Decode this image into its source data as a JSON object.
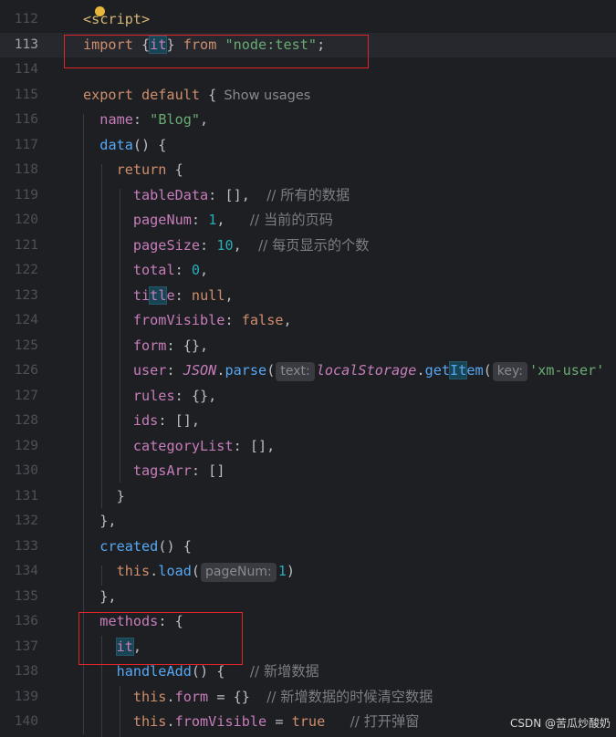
{
  "watermark": "CSDN @苦瓜炒酸奶",
  "colors": {
    "background": "#1e1f22",
    "keyword": "#cf8e6d",
    "string": "#6aab73",
    "number": "#2aacb8",
    "property": "#c77dbb",
    "function": "#56a8f5",
    "comment": "#7a7e85",
    "annotation_box": "#e0242a"
  },
  "lines": [
    {
      "n": "112",
      "seg": [
        [
          "tag",
          "<"
        ],
        [
          "tag",
          "s"
        ],
        [
          "tag",
          "cript"
        ],
        [
          "tag",
          ">"
        ]
      ]
    },
    {
      "n": "113",
      "current": true,
      "seg": [
        [
          "kw",
          "import "
        ],
        [
          "plain",
          "{"
        ],
        [
          "hl",
          "it"
        ],
        [
          "plain",
          "} "
        ],
        [
          "kw",
          "from "
        ],
        [
          "str",
          "\"node:test\""
        ],
        [
          "plain",
          ";"
        ]
      ]
    },
    {
      "n": "114",
      "seg": []
    },
    {
      "n": "115",
      "seg": [
        [
          "kw",
          "export default "
        ],
        [
          "plain",
          "{"
        ],
        [
          "usages",
          "Show usages"
        ]
      ]
    },
    {
      "n": "116",
      "seg": [
        [
          "plain",
          "  "
        ],
        [
          "prop",
          "name"
        ],
        [
          "plain",
          ": "
        ],
        [
          "str",
          "\"Blog\""
        ],
        [
          "plain",
          ","
        ]
      ]
    },
    {
      "n": "117",
      "seg": [
        [
          "plain",
          "  "
        ],
        [
          "fn",
          "data"
        ],
        [
          "plain",
          "() {"
        ]
      ]
    },
    {
      "n": "118",
      "seg": [
        [
          "plain",
          "    "
        ],
        [
          "kw",
          "return "
        ],
        [
          "plain",
          "{"
        ]
      ]
    },
    {
      "n": "119",
      "seg": [
        [
          "plain",
          "      "
        ],
        [
          "prop",
          "tableData"
        ],
        [
          "plain",
          ": [],  "
        ],
        [
          "com",
          "// 所有的数据"
        ]
      ]
    },
    {
      "n": "120",
      "seg": [
        [
          "plain",
          "      "
        ],
        [
          "prop",
          "pageNum"
        ],
        [
          "plain",
          ": "
        ],
        [
          "num",
          "1"
        ],
        [
          "plain",
          ",   "
        ],
        [
          "com",
          "// 当前的页码"
        ]
      ]
    },
    {
      "n": "121",
      "seg": [
        [
          "plain",
          "      "
        ],
        [
          "prop",
          "pageSize"
        ],
        [
          "plain",
          ": "
        ],
        [
          "num",
          "10"
        ],
        [
          "plain",
          ",  "
        ],
        [
          "com",
          "// 每页显示的个数"
        ]
      ]
    },
    {
      "n": "122",
      "seg": [
        [
          "plain",
          "      "
        ],
        [
          "prop",
          "total"
        ],
        [
          "plain",
          ": "
        ],
        [
          "num",
          "0"
        ],
        [
          "plain",
          ","
        ]
      ]
    },
    {
      "n": "123",
      "seg": [
        [
          "plain",
          "      "
        ],
        [
          "prop",
          "ti"
        ],
        [
          "prophl",
          "tl"
        ],
        [
          "prop",
          "e"
        ],
        [
          "plain",
          ": "
        ],
        [
          "kw",
          "null"
        ],
        [
          "plain",
          ","
        ]
      ]
    },
    {
      "n": "124",
      "seg": [
        [
          "plain",
          "      "
        ],
        [
          "prop",
          "fromVisible"
        ],
        [
          "plain",
          ": "
        ],
        [
          "kw",
          "false"
        ],
        [
          "plain",
          ","
        ]
      ]
    },
    {
      "n": "125",
      "seg": [
        [
          "plain",
          "      "
        ],
        [
          "prop",
          "form"
        ],
        [
          "plain",
          ": {},"
        ]
      ]
    },
    {
      "n": "126",
      "seg": [
        [
          "plain",
          "      "
        ],
        [
          "prop",
          "user"
        ],
        [
          "plain",
          ": "
        ],
        [
          "it",
          "JSON"
        ],
        [
          "plain",
          "."
        ],
        [
          "fn",
          "parse"
        ],
        [
          "plain",
          "("
        ],
        [
          "hint",
          "text:"
        ],
        [
          "it",
          "localStorage"
        ],
        [
          "plain",
          "."
        ],
        [
          "fn",
          "get"
        ],
        [
          "fnhl",
          "It"
        ],
        [
          "fn",
          "em"
        ],
        [
          "plain",
          "("
        ],
        [
          "hint",
          "key:"
        ],
        [
          "str",
          "'xm-user'"
        ]
      ]
    },
    {
      "n": "127",
      "seg": [
        [
          "plain",
          "      "
        ],
        [
          "prop",
          "rules"
        ],
        [
          "plain",
          ": {},"
        ]
      ]
    },
    {
      "n": "128",
      "seg": [
        [
          "plain",
          "      "
        ],
        [
          "prop",
          "ids"
        ],
        [
          "plain",
          ": [],"
        ]
      ]
    },
    {
      "n": "129",
      "seg": [
        [
          "plain",
          "      "
        ],
        [
          "prop",
          "categoryList"
        ],
        [
          "plain",
          ": [],"
        ]
      ]
    },
    {
      "n": "130",
      "seg": [
        [
          "plain",
          "      "
        ],
        [
          "prop",
          "tagsArr"
        ],
        [
          "plain",
          ": []"
        ]
      ]
    },
    {
      "n": "131",
      "seg": [
        [
          "plain",
          "    }"
        ]
      ]
    },
    {
      "n": "132",
      "seg": [
        [
          "plain",
          "  },"
        ]
      ]
    },
    {
      "n": "133",
      "seg": [
        [
          "plain",
          "  "
        ],
        [
          "fn",
          "created"
        ],
        [
          "plain",
          "() {"
        ]
      ]
    },
    {
      "n": "134",
      "seg": [
        [
          "plain",
          "    "
        ],
        [
          "kw",
          "this"
        ],
        [
          "plain",
          "."
        ],
        [
          "fn",
          "load"
        ],
        [
          "plain",
          "("
        ],
        [
          "hint",
          "pageNum:"
        ],
        [
          "num",
          "1"
        ],
        [
          "plain",
          ")"
        ]
      ]
    },
    {
      "n": "135",
      "seg": [
        [
          "plain",
          "  },"
        ]
      ]
    },
    {
      "n": "136",
      "seg": [
        [
          "plain",
          "  "
        ],
        [
          "prop",
          "methods"
        ],
        [
          "plain",
          ": {"
        ]
      ]
    },
    {
      "n": "137",
      "seg": [
        [
          "plain",
          "    "
        ],
        [
          "hl",
          "it"
        ],
        [
          "plain",
          ","
        ]
      ]
    },
    {
      "n": "138",
      "seg": [
        [
          "plain",
          "    "
        ],
        [
          "fn",
          "handleAdd"
        ],
        [
          "plain",
          "() {   "
        ],
        [
          "com",
          "// 新增数据"
        ]
      ]
    },
    {
      "n": "139",
      "seg": [
        [
          "plain",
          "      "
        ],
        [
          "kw",
          "this"
        ],
        [
          "plain",
          "."
        ],
        [
          "prop",
          "form"
        ],
        [
          "plain",
          " = {}  "
        ],
        [
          "com",
          "// 新增数据的时候清空数据"
        ]
      ]
    },
    {
      "n": "140",
      "seg": [
        [
          "plain",
          "      "
        ],
        [
          "kw",
          "this"
        ],
        [
          "plain",
          "."
        ],
        [
          "prop",
          "fromVisible"
        ],
        [
          "plain",
          " = "
        ],
        [
          "kw",
          "true"
        ],
        [
          "plain",
          "   "
        ],
        [
          "com",
          "// 打开弹窗"
        ]
      ]
    }
  ]
}
